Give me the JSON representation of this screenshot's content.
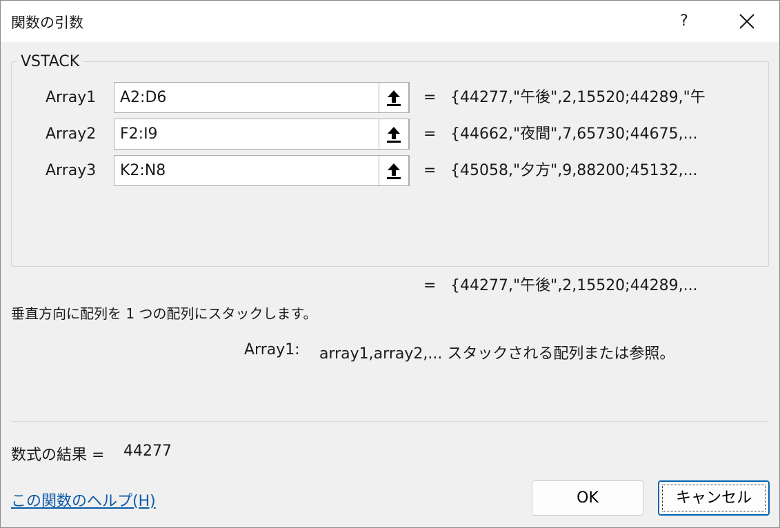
{
  "window": {
    "title": "関数の引数",
    "help_label": "?",
    "close_icon": "close-icon"
  },
  "function": {
    "name": "VSTACK",
    "arguments": [
      {
        "label": "Array1",
        "input": "A2:D6",
        "value": "{44277,\"午後\",2,15520;44289,\"午"
      },
      {
        "label": "Array2",
        "input": "F2:I9",
        "value": "{44662,\"夜間\",7,65730;44675,..."
      },
      {
        "label": "Array3",
        "input": "K2:N8",
        "value": "{45058,\"夕方\",9,88200;45132,..."
      }
    ],
    "equals": "=",
    "overall_value": "{44277,\"午後\",2,15520;44289,...",
    "description": "垂直方向に配列を 1 つの配列にスタックします。",
    "arg_help_name": "Array1:",
    "arg_help_text": "array1,array2,... スタックされる配列または参照。"
  },
  "result": {
    "label": "数式の結果 =",
    "value": "44277"
  },
  "footer": {
    "help_link": "この関数のヘルプ(H)",
    "ok_label": "OK",
    "cancel_label": "キャンセル"
  },
  "colors": {
    "link": "#0a5aa8",
    "focus_border": "#0063b1",
    "dialog_bg": "#f0f0f0"
  }
}
